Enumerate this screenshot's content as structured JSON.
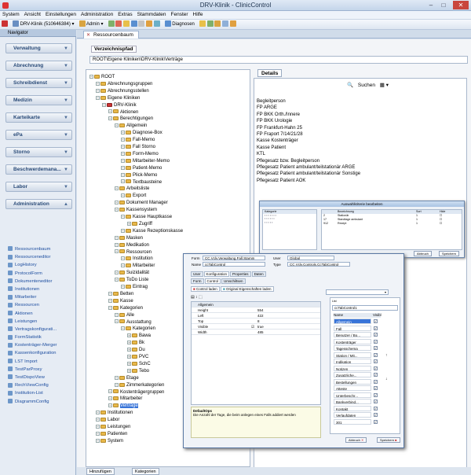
{
  "window": {
    "title": "DRV-Klinik - ClinicControl"
  },
  "menu": [
    "System",
    "Ansicht",
    "Einstellungen",
    "Administration",
    "Extras",
    "Stammdaten",
    "Fenster",
    "Hilfe"
  ],
  "toolbar": {
    "clinic": "DRV-Klinik (510646384)",
    "user": "Admin",
    "diagnosis": "Diagnosen"
  },
  "navigator": {
    "title": "Navigator",
    "groups": [
      "Verwaltung",
      "Abrechnung",
      "Schreibdienst",
      "Medizin",
      "Karteikarte",
      "ePa",
      "Storno",
      "Beschwerdemana...",
      "Labor",
      "Administration"
    ],
    "items": [
      "Ressourcenbaum",
      "Ressourceneditor",
      "LogHistory",
      "ProtocolForm",
      "Dokumenteneditor",
      "Institutionen",
      "Mitarbeiter",
      "Ressourcen",
      "Aktionen",
      "Leistungen",
      "Vertragskonfigurati...",
      "FormStatistik",
      "Kostenträger-Merger",
      "Kassenkonfiguration",
      "LST Import",
      "TestParProxy",
      "TestDispoView",
      "RechViewConfig",
      "Institution-List",
      "DiagrammConfig"
    ]
  },
  "tab": {
    "label": "Ressourcenbaum"
  },
  "path": {
    "label": "Verzeichnispfad",
    "value": "ROOT\\Eigene Kliniken\\DRV-Klinik\\Verträge"
  },
  "tree": [
    {
      "t": "ROOT",
      "l": 0
    },
    {
      "t": "Abrechnungsgruppen",
      "l": 1
    },
    {
      "t": "Abrechnungsstellen",
      "l": 1
    },
    {
      "t": "Eigene Kliniken",
      "l": 1
    },
    {
      "t": "DRV-Klinik",
      "l": 2
    },
    {
      "t": "Aktionen",
      "l": 3
    },
    {
      "t": "Berechtigungen",
      "l": 3
    },
    {
      "t": "Allgemein",
      "l": 4
    },
    {
      "t": "Diagnose-Box",
      "l": 5
    },
    {
      "t": "Fall-Memo",
      "l": 5
    },
    {
      "t": "Fall Storno",
      "l": 5
    },
    {
      "t": "Form-Memo",
      "l": 5
    },
    {
      "t": "Mitarbeiter-Memo",
      "l": 5
    },
    {
      "t": "Patient-Memo",
      "l": 5
    },
    {
      "t": "Plick-Memo",
      "l": 5
    },
    {
      "t": "Textbausteine",
      "l": 5
    },
    {
      "t": "Arbeitsliste",
      "l": 4
    },
    {
      "t": "Export",
      "l": 5
    },
    {
      "t": "Dokument Manager",
      "l": 4
    },
    {
      "t": "Kassensystem",
      "l": 4
    },
    {
      "t": "Kasse Hauptkasse",
      "l": 5
    },
    {
      "t": "Zugriff",
      "l": 6
    },
    {
      "t": "Kasse Rezeptionskasse",
      "l": 5
    },
    {
      "t": "Masken",
      "l": 4
    },
    {
      "t": "Medikation",
      "l": 4
    },
    {
      "t": "Ressourcen",
      "l": 4
    },
    {
      "t": "Institution",
      "l": 5
    },
    {
      "t": "Mitarbeiter",
      "l": 5
    },
    {
      "t": "Suizidalität",
      "l": 4
    },
    {
      "t": "ToDo Liste",
      "l": 4
    },
    {
      "t": "Eintrag",
      "l": 5
    },
    {
      "t": "Betten",
      "l": 3
    },
    {
      "t": "Kasse",
      "l": 3
    },
    {
      "t": "Kategorien",
      "l": 3
    },
    {
      "t": "Alle",
      "l": 4
    },
    {
      "t": "Ausstattung",
      "l": 4
    },
    {
      "t": "Kategorien",
      "l": 5
    },
    {
      "t": "Bawa",
      "l": 6
    },
    {
      "t": "Bk",
      "l": 6
    },
    {
      "t": "Du",
      "l": 6
    },
    {
      "t": "PVC",
      "l": 6
    },
    {
      "t": "SchC",
      "l": 6
    },
    {
      "t": "Tebo",
      "l": 6
    },
    {
      "t": "Etage",
      "l": 4
    },
    {
      "t": "Zimmerkategorien",
      "l": 4
    },
    {
      "t": "Kostenträgergruppen",
      "l": 3
    },
    {
      "t": "Mitarbeiter",
      "l": 3
    },
    {
      "t": "Verträge",
      "l": 3
    },
    {
      "t": "Institutionen",
      "l": 1
    },
    {
      "t": "Labor",
      "l": 1
    },
    {
      "t": "Leistungen",
      "l": 1
    },
    {
      "t": "Patienten",
      "l": 1
    },
    {
      "t": "System",
      "l": 1
    }
  ],
  "details": {
    "tab": "Details",
    "search": "Suchen",
    "items": [
      "Begleitperson",
      "FP ARGE",
      "FP BKK Orth./Innere",
      "FP BKK Urologie",
      "FP Frankfurt-Hahn 25",
      "FP Fraport 7/14/21/28",
      "Kasse Kostenträger",
      "Kasse Patient",
      "KTL",
      "Pflegesatz bzw. Begleitperson",
      "Pflegesatz Patient ambulant/teilstationär ARGE",
      "Pflegesatz Patient ambulant/teilstationär Sonstige",
      "Pflegesatz Patient AOK"
    ]
  },
  "popup1": {
    "title": "Auswahlkriterie bearbeiten",
    "col1": "Kategorie",
    "col2": "Bezeichnung",
    "col3": "Sort",
    "col4": "Hide",
    "abbruch": "Abbruch",
    "speichern": "Speichern",
    "rows": [
      [
        "2",
        "Stationär",
        "1"
      ],
      [
        "17",
        "Standtage ambulant",
        "1"
      ],
      [
        "912",
        "Rezept",
        "1"
      ]
    ]
  },
  "popup2": {
    "form_label": "Form",
    "form_value": "CC.Vclv.Verwaltung.Fall.Stamm",
    "name_label": "Name",
    "name_value": "ccTabControl",
    "user_label": "User",
    "user_value": "Global",
    "type_label": "Type",
    "type_value": "CC.Vclv.Controls.CcTabControl",
    "tabs": [
      "User",
      "Konfiguration",
      "Properties",
      "Daten"
    ],
    "subtabs": [
      "Form",
      "Control",
      "Umschiltsen"
    ],
    "btn_load": "Control laden",
    "btn_orig": "Original Eigenschaften laden",
    "props": [
      [
        "Allgemein",
        ""
      ],
      [
        "Height",
        "554"
      ],
      [
        "Left",
        "422"
      ],
      [
        "Top",
        "8"
      ],
      [
        "Visible",
        "true"
      ],
      [
        "Width",
        "485"
      ]
    ],
    "desc_title": "DefaultOps",
    "desc": "Die Anzahl der Tage, die beim anlegen eines Falls addiert werden",
    "list_label": "List",
    "list_value": "ccTabControl1",
    "col_name": "Name",
    "col_visible": "Visibl",
    "list": [
      "Allgemein",
      "Fall",
      "Benutzer / Bo...",
      "Kostenträger",
      "Tagesschema",
      "Station / Mit...",
      "Indikation",
      "Notizen",
      "Zusatzliche...",
      "Bestellungen",
      "Atteste",
      "Unterbeschr...",
      "Bankverbind...",
      "Kontakt",
      "Verlaufdaten",
      "301"
    ],
    "abbruch": "Abbruch",
    "speichern": "Speichern"
  },
  "bottom": {
    "btn1": "Hinzufügen",
    "btn2": "Kategorien"
  }
}
